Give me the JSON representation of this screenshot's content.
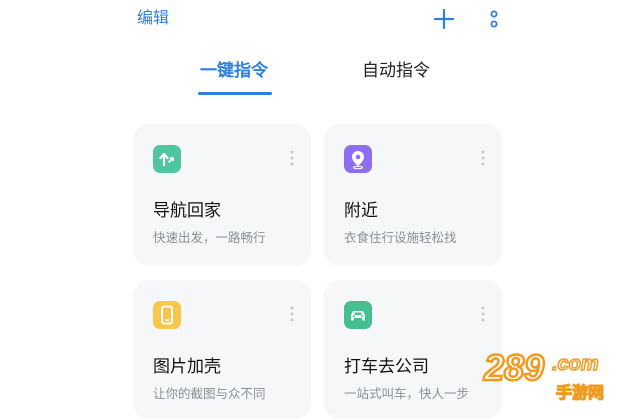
{
  "header": {
    "edit_label": "编辑",
    "add_icon": "plus-icon",
    "more_icon": "more-vertical-icon"
  },
  "tabs": [
    {
      "label": "一键指令",
      "active": true
    },
    {
      "label": "自动指令",
      "active": false
    }
  ],
  "colors": {
    "accent": "#2f7fe0",
    "card_bg": "#f6f7f9",
    "nav_icon": "#4fc6a0",
    "nearby_icon": "#8b6ff0",
    "shell_icon": "#f7c64a",
    "taxi_icon": "#45bf8f"
  },
  "cards": [
    {
      "title": "导航回家",
      "subtitle": "快速出发，一路畅行",
      "icon": "navigate-home-icon"
    },
    {
      "title": "附近",
      "subtitle": "衣食住行设施轻松找",
      "icon": "location-pin-icon"
    },
    {
      "title": "图片加壳",
      "subtitle": "让你的截图与众不同",
      "icon": "phone-frame-icon"
    },
    {
      "title": "打车去公司",
      "subtitle": "一站式叫车，快人一步",
      "icon": "car-icon"
    }
  ],
  "watermark": {
    "brand": "289.com",
    "sub": "手游网"
  }
}
